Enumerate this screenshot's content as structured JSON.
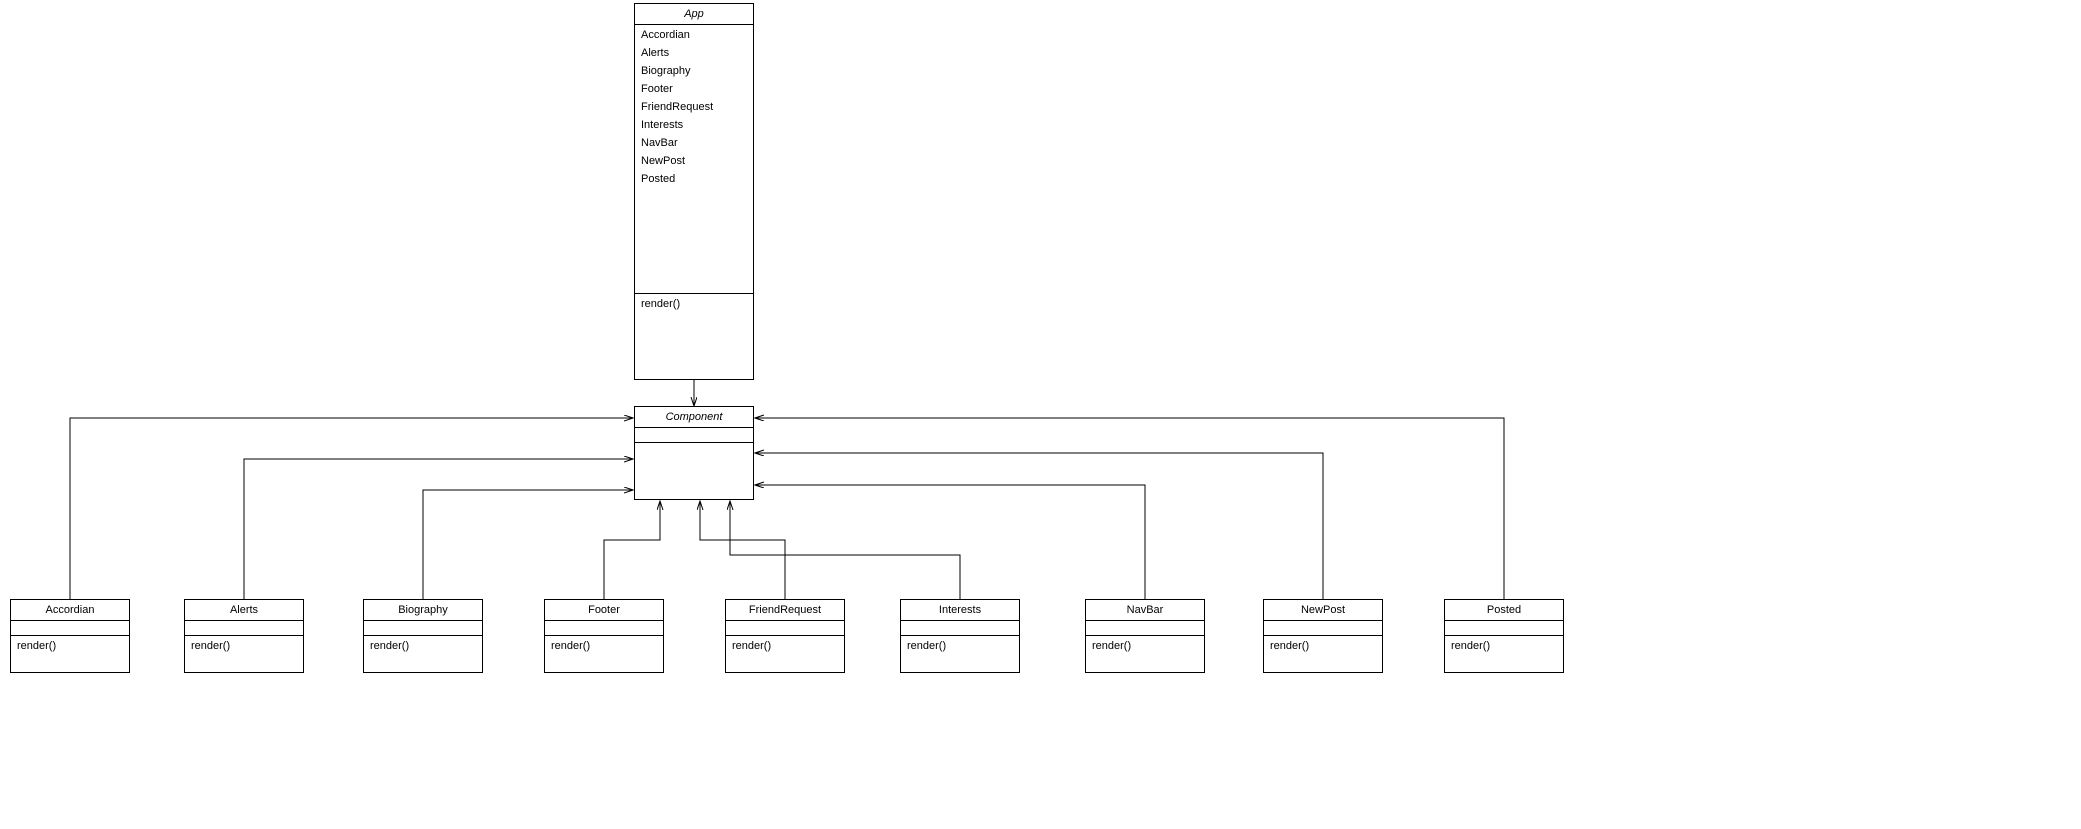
{
  "app": {
    "title": "App",
    "attributes": [
      "Accordian",
      "Alerts",
      "Biography",
      "Footer",
      "FriendRequest",
      "Interests",
      "NavBar",
      "NewPost",
      "Posted"
    ],
    "operation": "render()"
  },
  "component": {
    "title": "Component"
  },
  "children": {
    "accordian": {
      "title": "Accordian",
      "operation": "render()"
    },
    "alerts": {
      "title": "Alerts",
      "operation": "render()"
    },
    "biography": {
      "title": "Biography",
      "operation": "render()"
    },
    "footer": {
      "title": "Footer",
      "operation": "render()"
    },
    "friendrequest": {
      "title": "FriendRequest",
      "operation": "render()"
    },
    "interests": {
      "title": "Interests",
      "operation": "render()"
    },
    "navbar": {
      "title": "NavBar",
      "operation": "render()"
    },
    "newpost": {
      "title": "NewPost",
      "operation": "render()"
    },
    "posted": {
      "title": "Posted",
      "operation": "render()"
    }
  }
}
